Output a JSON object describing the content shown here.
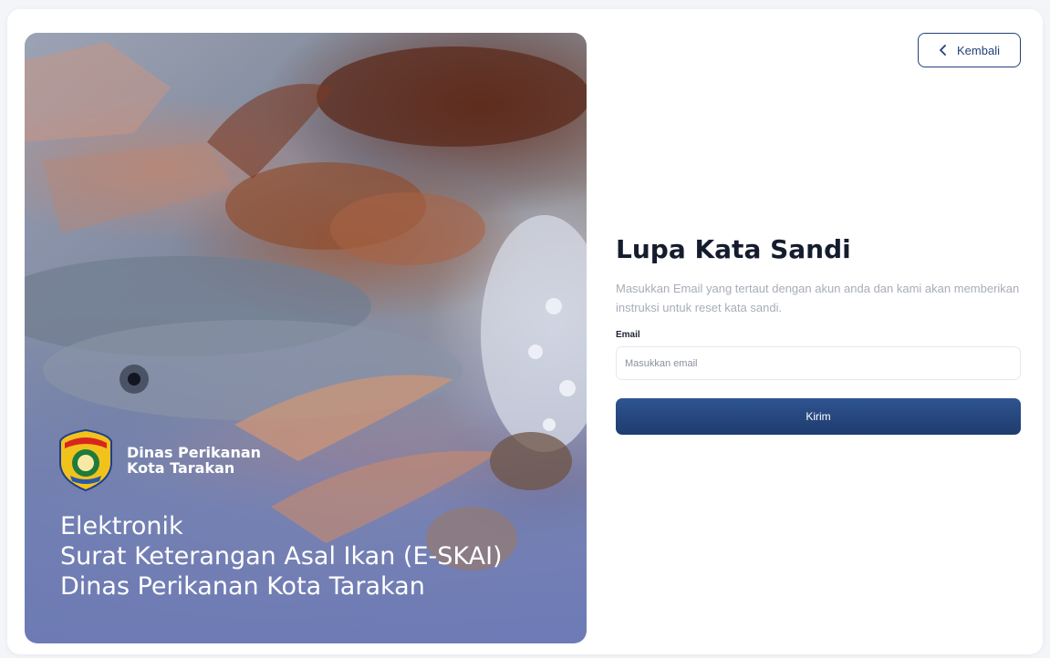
{
  "hero": {
    "org_line1": "Dinas Perikanan",
    "org_line2": "Kota Tarakan",
    "emblem_text": "KOTA TARAKAN",
    "title_line1": "Elektronik",
    "title_line2": "Surat Keterangan Asal Ikan (E-SKAI)",
    "title_line3": "Dinas Perikanan Kota Tarakan"
  },
  "header": {
    "back_label": "Kembali",
    "back_icon": "chevron-left-icon"
  },
  "form": {
    "title": "Lupa Kata Sandi",
    "description": "Masukkan Email yang tertaut dengan akun anda dan kami akan memberikan instruksi untuk reset kata sandi.",
    "email_label": "Email",
    "email_placeholder": "Masukkan email",
    "email_value": "",
    "submit_label": "Kirim"
  },
  "colors": {
    "primary": "#24417a",
    "hero_overlay": "#6c7ab6",
    "muted_text": "#a7adb8"
  }
}
